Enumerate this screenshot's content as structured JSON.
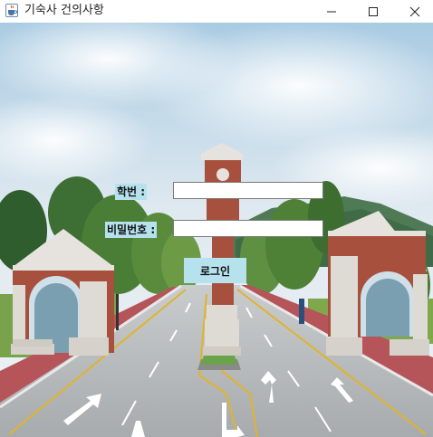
{
  "window": {
    "title": "기숙사 건의사항",
    "icon": "java-cup-icon",
    "controls": [
      "minimize-icon",
      "maximize-icon",
      "close-icon"
    ]
  },
  "form": {
    "student_id_label": "학번 :",
    "student_id_value": "",
    "password_label": "비밀번호 :",
    "password_value": "",
    "login_label": "로그인"
  },
  "colors": {
    "label_bg": "#b6e2ee",
    "button_bg": "#b6e2ee",
    "sky": "#cfe3ef",
    "road": "#b9bdbf",
    "brick": "#a8503e"
  }
}
